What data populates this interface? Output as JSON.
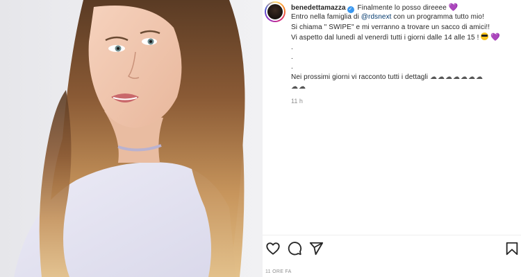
{
  "post": {
    "username": "benedettamazza",
    "relative_time": "11 h",
    "timestamp_label": "11 ORE FA"
  },
  "caption": {
    "line1_text": "Finalmente lo posso direeee",
    "line2_before": "Entro nella famiglia di ",
    "line2_mention": "@rdsnext",
    "line2_after": " con un programma tutto mio!",
    "line3": "Si chiama \" SWIPE\" e mi verranno a trovare un sacco di amici!!",
    "line4_text": "Vi aspetto dal lunedì al venerdì tutti i giorni dalle 14 alle 15 !",
    "dots": [
      ".",
      ".",
      "."
    ],
    "line5_text": "Nei prossimi giorni vi racconto tutti i dettagli",
    "clouds_line1": "☁☁☁☁☁☁☁",
    "clouds_line2": "☁☁"
  },
  "icons": {
    "verified": "verified-badge-icon",
    "heart_emoji": "purple-heart-emoji",
    "cool_emoji": "sunglasses-face-emoji",
    "like": "heart-outline-icon",
    "comment": "speech-bubble-icon",
    "share": "paper-plane-icon",
    "save": "bookmark-icon"
  },
  "glyphs": {
    "verified": "✓",
    "heart_emoji": "💜"
  },
  "colors": {
    "text": "#262626",
    "muted": "#8e8e8e",
    "mention": "#00376b",
    "verified": "#3897f0",
    "divider": "#efefef"
  }
}
